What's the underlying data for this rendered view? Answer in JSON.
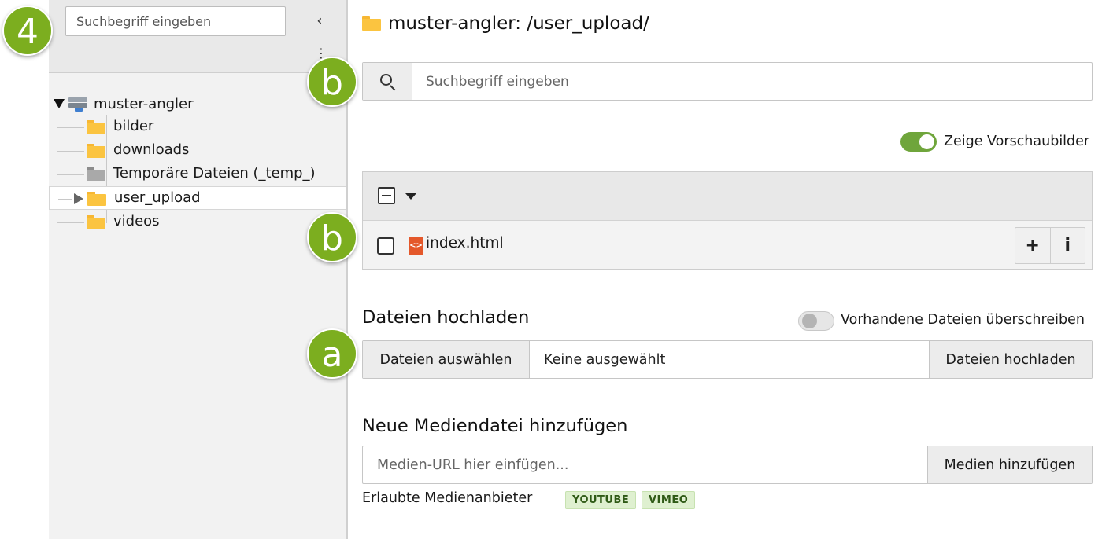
{
  "annotations": {
    "step_number": "4",
    "marker_b": "b",
    "marker_a": "a"
  },
  "sidebar": {
    "search_placeholder": "Suchbegriff eingeben",
    "collapse_icon": "chevron-left-icon",
    "menu_icon": "kebab-menu-icon",
    "tree": {
      "root_label": "muster-angler",
      "items": [
        {
          "label": "bilder",
          "folder_color": "#fbc440"
        },
        {
          "label": "downloads",
          "folder_color": "#fbc440"
        },
        {
          "label": "Temporäre Dateien (_temp_)",
          "folder_color": "#a9a9a9"
        },
        {
          "label": "user_upload",
          "folder_color": "#fbc440",
          "selected": true
        },
        {
          "label": "videos",
          "folder_color": "#fbc440"
        }
      ]
    }
  },
  "main": {
    "title": "muster-angler: /user_upload/",
    "search": {
      "placeholder": "Suchbegriff eingeben",
      "icon": "search-icon"
    },
    "thumbnails_toggle": {
      "label": "Zeige Vorschaubilder",
      "on": true
    },
    "files": [
      {
        "name": "index.html",
        "icon": "html-file-icon"
      }
    ],
    "row_actions": {
      "add": "+",
      "info": "i"
    },
    "upload": {
      "title": "Dateien hochladen",
      "overwrite_label": "Vorhandene Dateien überschreiben",
      "overwrite_on": false,
      "choose_label": "Dateien auswählen",
      "none_selected": "Keine ausgewählt",
      "submit_label": "Dateien hochladen"
    },
    "media": {
      "title": "Neue Mediendatei hinzufügen",
      "placeholder": "Medien-URL hier einfügen...",
      "add_label": "Medien hinzufügen",
      "providers_label": "Erlaubte Medienanbieter",
      "providers": [
        "YOUTUBE",
        "VIMEO"
      ]
    }
  },
  "colors": {
    "badge_green": "#7cae1f",
    "toggle_on": "#6fa53b",
    "folder_yellow": "#fbc440",
    "html_icon": "#e4582b"
  }
}
